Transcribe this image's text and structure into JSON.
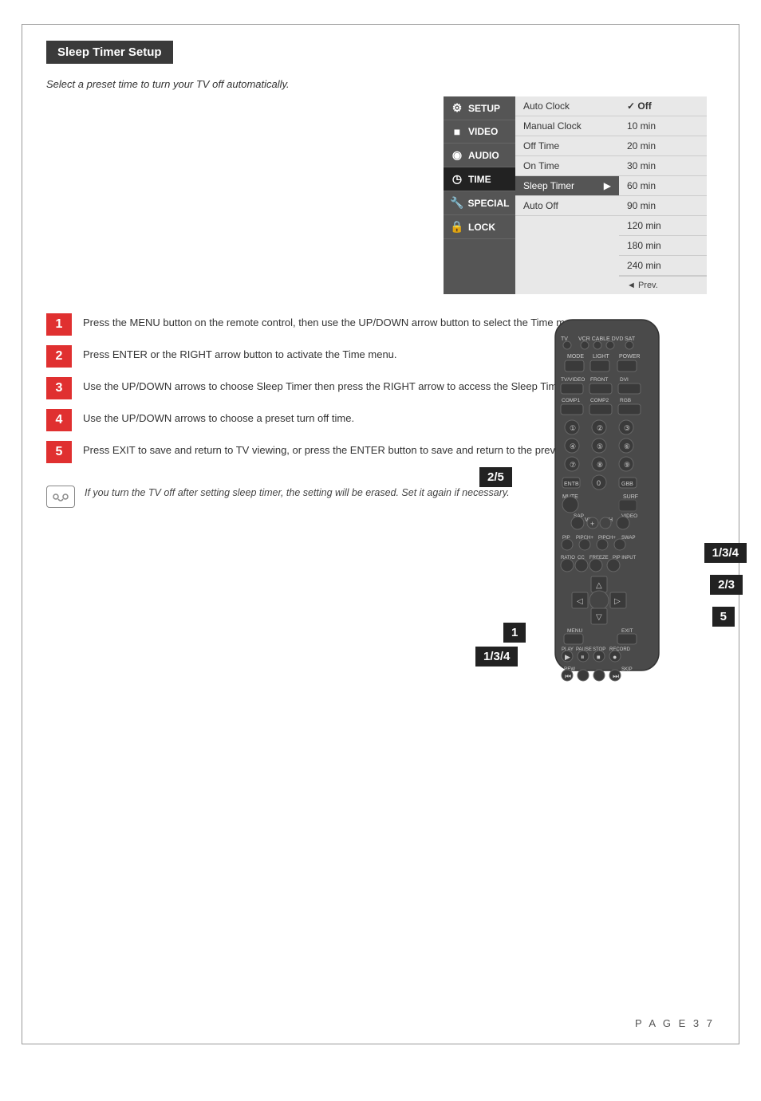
{
  "page": {
    "title": "Sleep Timer Setup",
    "description": "Select a preset time to turn your TV off automatically.",
    "page_number": "P A G E   3 7"
  },
  "menu": {
    "left_items": [
      {
        "label": "SETUP",
        "icon": "⚙"
      },
      {
        "label": "VIDEO",
        "icon": "■"
      },
      {
        "label": "AUDIO",
        "icon": "🔊"
      },
      {
        "label": "TIME",
        "icon": "🕐"
      },
      {
        "label": "SPECIAL",
        "icon": "🔧"
      },
      {
        "label": "LOCK",
        "icon": "🔒"
      }
    ],
    "middle_items": [
      {
        "label": "Auto Clock",
        "active": false
      },
      {
        "label": "Manual Clock",
        "active": false
      },
      {
        "label": "Off Time",
        "active": false
      },
      {
        "label": "On Time",
        "active": false
      },
      {
        "label": "Sleep Timer",
        "active": true,
        "arrow": "▶"
      },
      {
        "label": "Auto Off",
        "active": false
      }
    ],
    "right_items": [
      {
        "label": "Off",
        "checked": true
      },
      {
        "label": "10 min"
      },
      {
        "label": "20 min"
      },
      {
        "label": "30 min"
      },
      {
        "label": "60 min"
      },
      {
        "label": "90 min"
      },
      {
        "label": "120 min"
      },
      {
        "label": "180 min"
      },
      {
        "label": "240 min"
      }
    ],
    "prev_label": "◄ Prev."
  },
  "steps": [
    {
      "number": "1",
      "text": "Press the MENU button on the remote control, then use the UP/DOWN arrow button to select the Time menu."
    },
    {
      "number": "2",
      "text": "Press ENTER or the RIGHT arrow button to activate the Time menu."
    },
    {
      "number": "3",
      "text": "Use the UP/DOWN arrows to choose Sleep Timer then press the RIGHT arrow to access the Sleep Timer menu."
    },
    {
      "number": "4",
      "text": "Use the UP/DOWN arrows to choose a preset turn off time."
    },
    {
      "number": "5",
      "text": "Press EXIT to save and return to TV viewing, or press the ENTER button to save and return to the previous menu."
    }
  ],
  "note": {
    "text": "If you turn the TV off after setting sleep timer, the setting will be erased. Set it again if necessary."
  },
  "remote_labels": {
    "label_25": "2/5",
    "label_134_top": "1/3/4",
    "label_134_bottom": "1/3/4",
    "label_23": "2/3",
    "label_5": "5",
    "label_1": "1"
  }
}
